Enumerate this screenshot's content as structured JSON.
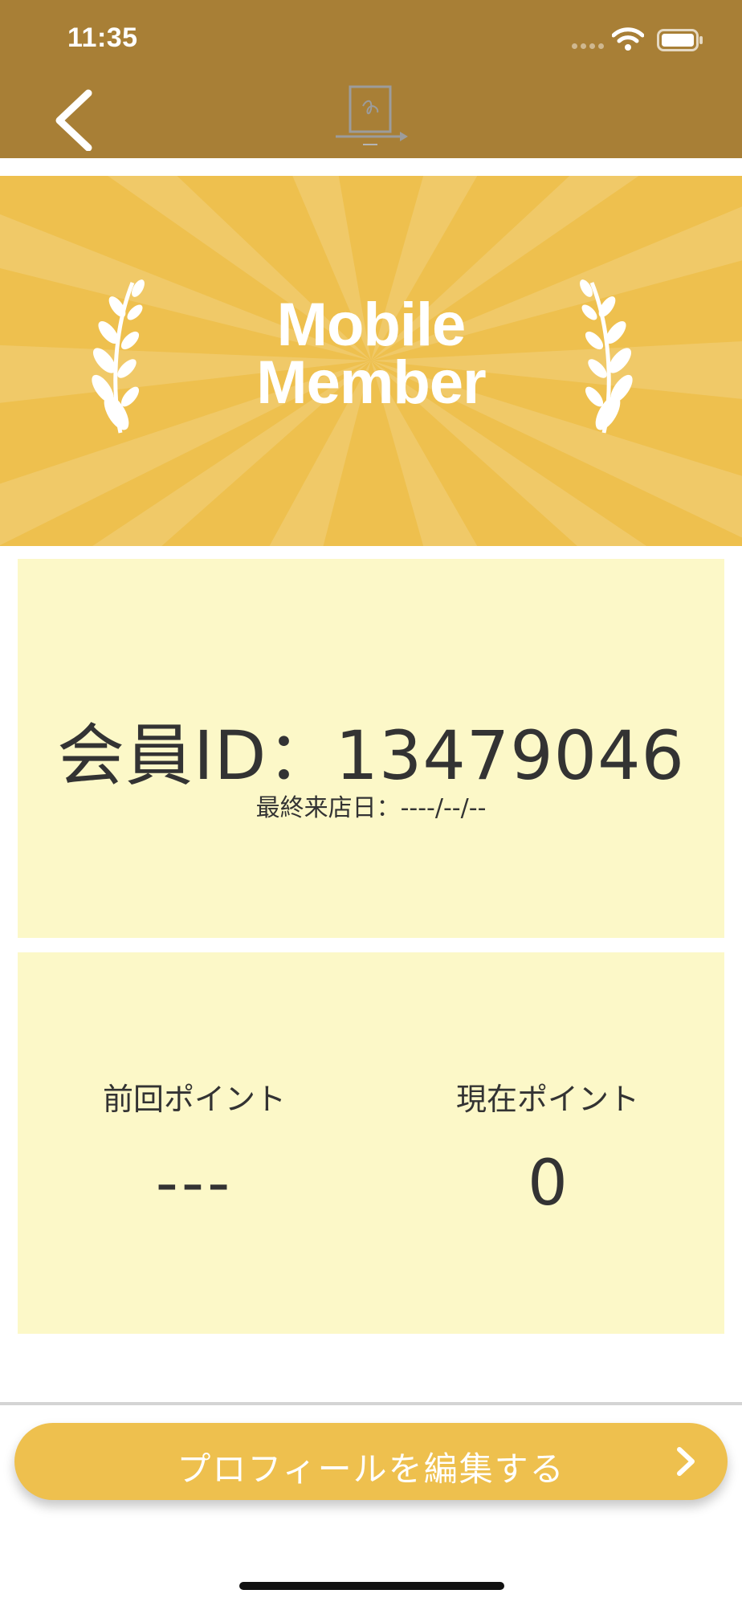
{
  "status_bar": {
    "time": "11:35"
  },
  "nav": {
    "back_icon": "chevron-left-icon",
    "logo_icon": "app-logo-icon"
  },
  "banner": {
    "title_line1": "Mobile",
    "title_line2": "Member",
    "laurel_icon": "laurel-icon"
  },
  "member": {
    "id_text": "会員ID：13479046",
    "last_visit_text": "最終来店日：----/--/--"
  },
  "points": {
    "previous_label": "前回ポイント",
    "previous_value": "---",
    "current_label": "現在ポイント",
    "current_value": "0"
  },
  "profile_button": {
    "label": "プロフィールを編集する",
    "icon": "chevron-right-icon"
  },
  "colors": {
    "header": "#a87f36",
    "banner": "#eec04e",
    "card": "#fcf8c8",
    "text": "#333333",
    "button": "#eec04e"
  }
}
